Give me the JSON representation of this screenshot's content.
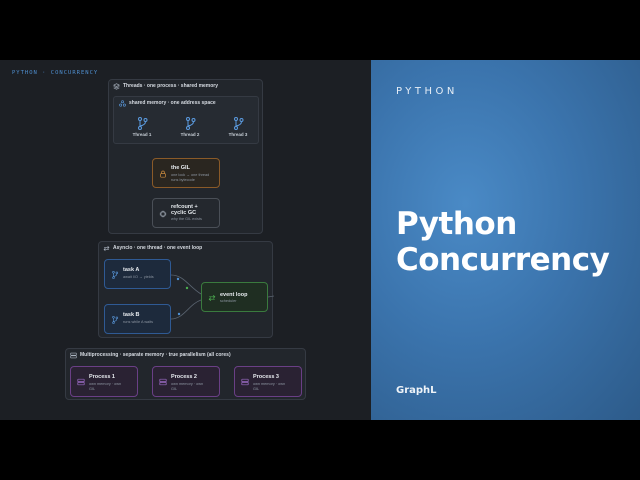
{
  "corner_label": "PYTHON · CONCURRENCY",
  "threads_panel": {
    "title": "Threads · one process · shared memory",
    "shared_memory": {
      "title": "shared memory · one address space",
      "threads": [
        "Thread 1",
        "Thread 2",
        "Thread 3"
      ]
    },
    "gil": {
      "title": "the GIL",
      "subtitle_1": "one lock → one thread",
      "subtitle_2": "runs bytecode"
    },
    "gc": {
      "title_1": "refcount +",
      "title_2": "cyclic GC",
      "subtitle": "why the GIL exists"
    }
  },
  "asyncio_panel": {
    "title": "Asyncio · one thread · one event loop",
    "task_a": {
      "title": "task A",
      "subtitle": "await I/O → yields"
    },
    "task_b": {
      "title": "task B",
      "subtitle": "runs while A waits"
    },
    "event_loop": {
      "title": "event loop",
      "subtitle": "scheduler"
    }
  },
  "mp_panel": {
    "title": "Multiprocessing · separate memory · true parallelism (all cores)",
    "processes": [
      {
        "title": "Process 1",
        "subtitle_1": "own memory · own",
        "subtitle_2": "GIL"
      },
      {
        "title": "Process 2",
        "subtitle_1": "own memory · own",
        "subtitle_2": "GIL"
      },
      {
        "title": "Process 3",
        "subtitle_1": "own memory · own",
        "subtitle_2": "GIL"
      }
    ]
  },
  "right": {
    "brand_top": "PYTHON",
    "title_line_1": "Python",
    "title_line_2": "Concurrency",
    "brand_bottom": "GraphL"
  },
  "colors": {
    "accent_blue": "#4f8fd0",
    "gil_orange": "#c98a3e",
    "loop_green": "#4caf50",
    "process_purple": "#9b6bc4"
  }
}
